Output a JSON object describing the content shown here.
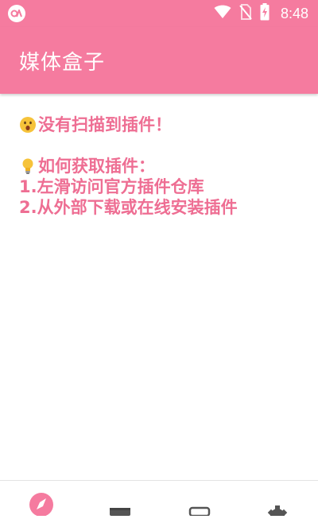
{
  "status_bar": {
    "time": "8:48",
    "icons": [
      "app-logo-icon",
      "wifi-icon",
      "no-sim-icon",
      "battery-charging-icon"
    ]
  },
  "app_bar": {
    "title": "媒体盒子"
  },
  "message": {
    "no_plugin_emoji": "astonished-face-icon",
    "no_plugin_text": "没有扫描到插件！",
    "tip_emoji": "lightbulb-icon",
    "how_to_title": "如何获取插件：",
    "steps": [
      "1.左滑访问官方插件仓库",
      "2.从外部下载或在线安装插件"
    ]
  },
  "bottom_nav": {
    "items": [
      {
        "icon": "compass-icon",
        "active": true
      },
      {
        "icon": "terminal-icon",
        "active": false
      },
      {
        "icon": "card-icon",
        "active": false
      },
      {
        "icon": "gear-icon",
        "active": false
      }
    ]
  },
  "colors": {
    "primary": "#f57b9f",
    "text_pink": "#ee6e93",
    "nav_active": "#f57b9f",
    "nav_inactive": "#555555"
  }
}
